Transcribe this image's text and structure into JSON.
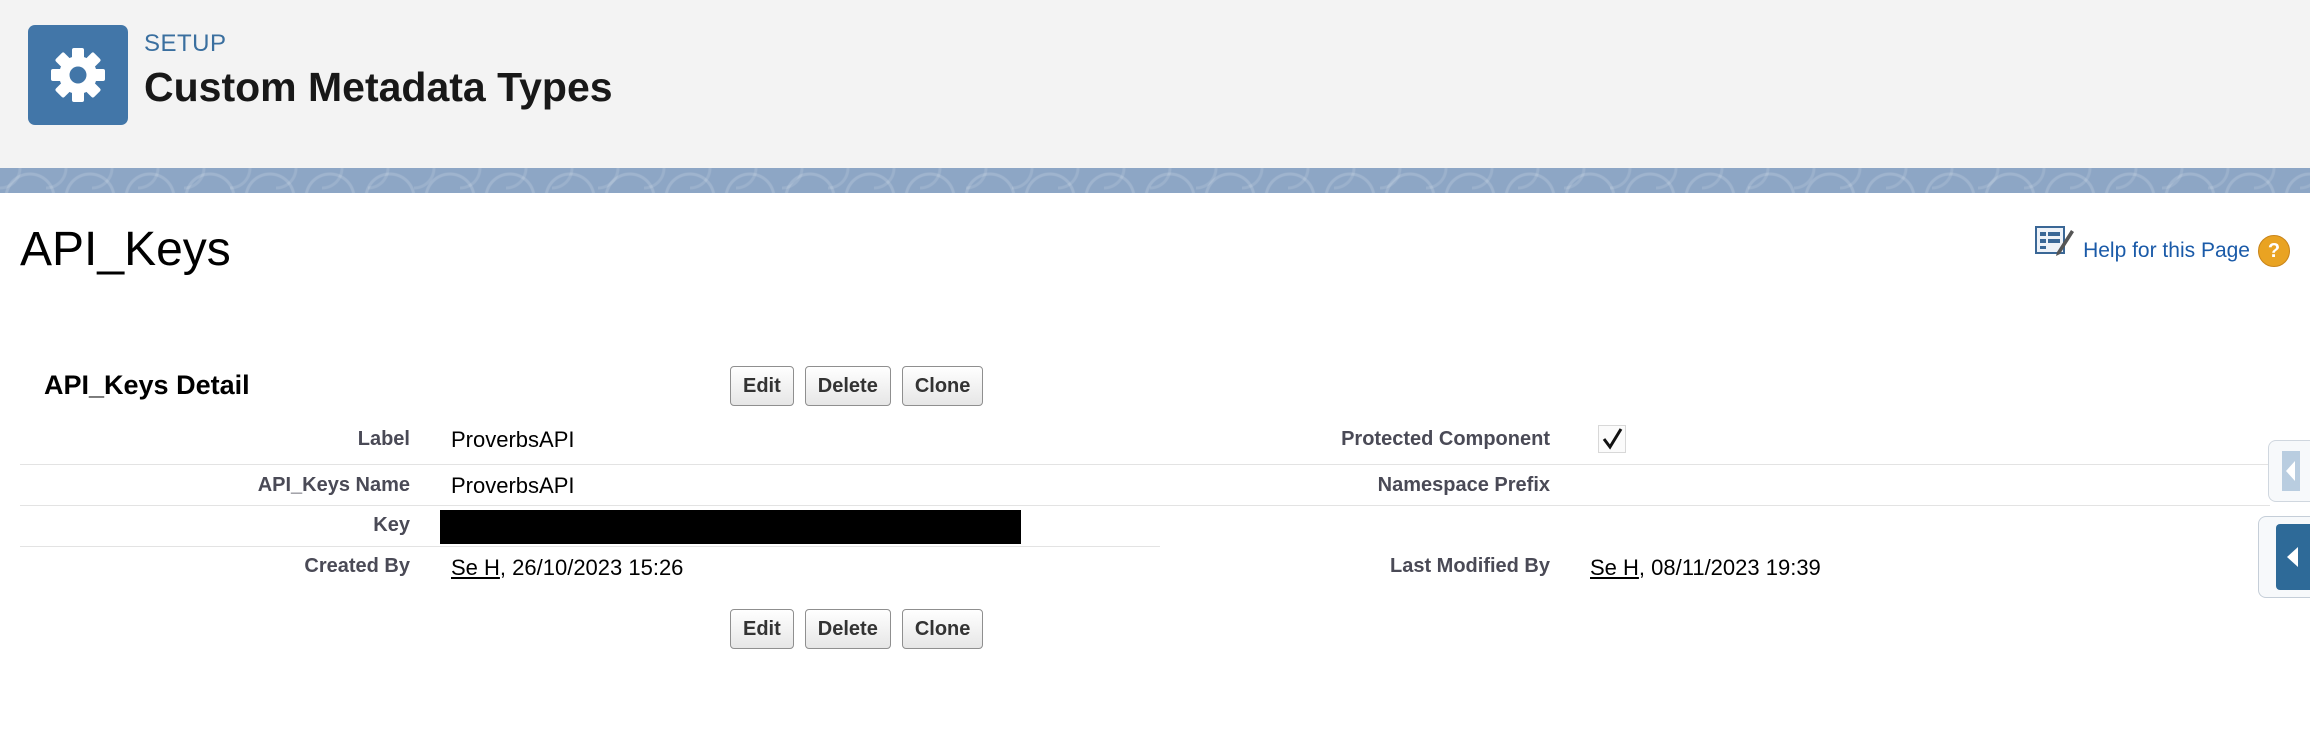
{
  "header": {
    "eyebrow": "SETUP",
    "title": "Custom Metadata Types",
    "icon": "gear-icon",
    "icon_color": "#4276a8"
  },
  "page": {
    "record_title": "API_Keys",
    "help_link": "Help for this Page",
    "help_icon": "question-icon"
  },
  "detail": {
    "section_title": "API_Keys Detail",
    "buttons": {
      "edit": "Edit",
      "delete": "Delete",
      "clone": "Clone"
    },
    "fields": {
      "label": {
        "label": "Label",
        "value": "ProverbsAPI"
      },
      "name": {
        "label": "API_Keys Name",
        "value": "ProverbsAPI"
      },
      "key": {
        "label": "Key",
        "value_redacted": true
      },
      "created_by": {
        "label": "Created By",
        "user": "Se H",
        "date": ", 26/10/2023 15:26"
      },
      "protected": {
        "label": "Protected Component",
        "checked": true
      },
      "namespace": {
        "label": "Namespace Prefix",
        "value": ""
      },
      "modified_by": {
        "label": "Last Modified By",
        "user": "Se H",
        "date": ", 08/11/2023 19:39"
      }
    }
  },
  "colors": {
    "link": "#1a5aa8",
    "header_bg": "#f3f3f3",
    "band": "#8da6c5",
    "edge_tab": "#2e6a98"
  }
}
